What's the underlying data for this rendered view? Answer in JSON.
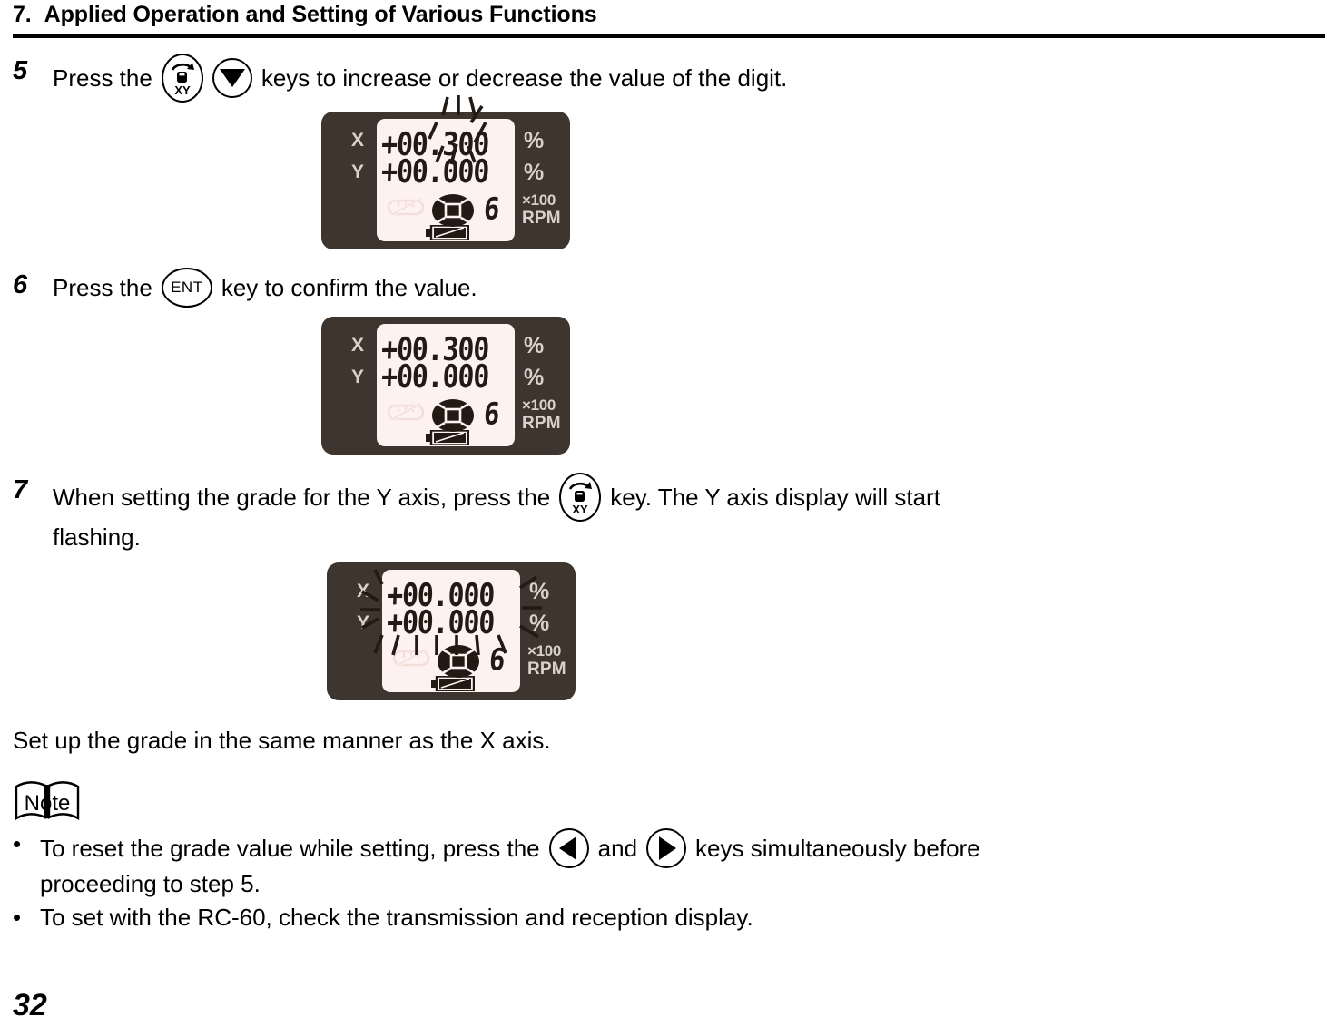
{
  "header": {
    "number": "7.",
    "title": "Applied Operation and Setting of Various Functions"
  },
  "steps": [
    {
      "number": "5",
      "text_before": "Press the",
      "key1": "xy-key",
      "key2": "down-arrow-key",
      "text_after": "keys to increase or decrease the value of the digit."
    },
    {
      "number": "6",
      "text_before": "Press the",
      "key1": "ENT",
      "text_after": "key to confirm the value."
    },
    {
      "number": "7",
      "text_before": "When setting the grade for the Y axis, press the",
      "key1": "xy-key",
      "text_after": "key. The Y axis display will start",
      "line2": "flashing."
    }
  ],
  "displays": [
    {
      "id": "lcd-step5",
      "x_label": "X",
      "y_label": "Y",
      "x_value": "+00.300",
      "y_value": "+00.000",
      "unit_x": "%",
      "unit_y": "%",
      "multiplier": "×100",
      "rpm_label": "RPM",
      "rpm_value": "6",
      "flashing": "x-digit",
      "battery_icon": "battery-icon",
      "rotor_icon": "rotor-icon",
      "laser_icon": "laser-off-icon"
    },
    {
      "id": "lcd-step6",
      "x_label": "X",
      "y_label": "Y",
      "x_value": "+00.300",
      "y_value": "+00.000",
      "unit_x": "%",
      "unit_y": "%",
      "multiplier": "×100",
      "rpm_label": "RPM",
      "rpm_value": "6",
      "flashing": "none",
      "battery_icon": "battery-icon",
      "rotor_icon": "rotor-icon",
      "laser_icon": "laser-off-icon"
    },
    {
      "id": "lcd-step7",
      "x_label": "X",
      "y_label": "Y",
      "x_value": "+00.000",
      "y_value": "+00.000",
      "unit_x": "%",
      "unit_y": "%",
      "multiplier": "×100",
      "rpm_label": "RPM",
      "rpm_value": "6",
      "flashing": "y-row",
      "battery_icon": "battery-icon",
      "rotor_icon": "rotor-icon",
      "laser_icon": "laser-off-icon"
    }
  ],
  "paragraph": "Set up the grade in the same manner as the X axis.",
  "note": {
    "label": "Note",
    "bullet": "•",
    "items": [
      {
        "part1": "To reset the grade value while setting, press the",
        "key1": "left-arrow-key",
        "conjunction": "and",
        "key2": "right-arrow-key",
        "part2": "keys simultaneously before",
        "line2": "proceeding to step 5."
      },
      {
        "part1": "To set with the RC-60, check the transmission and reception display."
      }
    ]
  },
  "footer": {
    "page_number": "32"
  },
  "colors": {
    "lcd_housing": "#3D352E",
    "lcd_face": "#FDF2F0",
    "lcd_segment": "#231A14",
    "lcd_label": "#D9D2CC",
    "text": "#000000",
    "page_bg": "#FFFFFF"
  }
}
